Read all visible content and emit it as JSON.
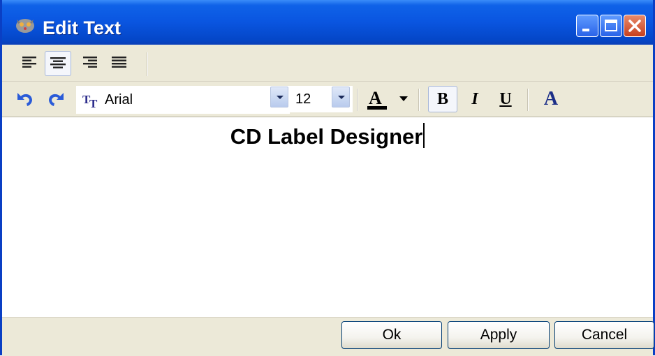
{
  "window": {
    "title": "Edit Text",
    "controls": {
      "minimize_icon": "minimize-icon",
      "maximize_icon": "maximize-icon",
      "close_icon": "close-icon"
    }
  },
  "toolbar1": {
    "align_buttons": [
      {
        "name": "align-left",
        "icon": "align-left-icon",
        "active": false
      },
      {
        "name": "align-center",
        "icon": "align-center-icon",
        "active": true
      },
      {
        "name": "align-right",
        "icon": "align-right-icon",
        "active": false
      },
      {
        "name": "align-justify",
        "icon": "align-justify-icon",
        "active": false
      }
    ]
  },
  "toolbar2": {
    "undo_icon": "undo-icon",
    "redo_icon": "redo-icon",
    "font_name": "Arial",
    "font_size": "12",
    "text_color": "#000000",
    "bold_label": "B",
    "italic_label": "I",
    "underline_label": "U",
    "bold_active": true,
    "font_dialog_label": "A"
  },
  "editor": {
    "content": "CD Label Designer"
  },
  "footer": {
    "ok_label": "Ok",
    "apply_label": "Apply",
    "cancel_label": "Cancel"
  },
  "colors": {
    "titlebar": "#0a55e0",
    "window_bg": "#ece9d8",
    "icon_blue": "#2a5bd8"
  }
}
